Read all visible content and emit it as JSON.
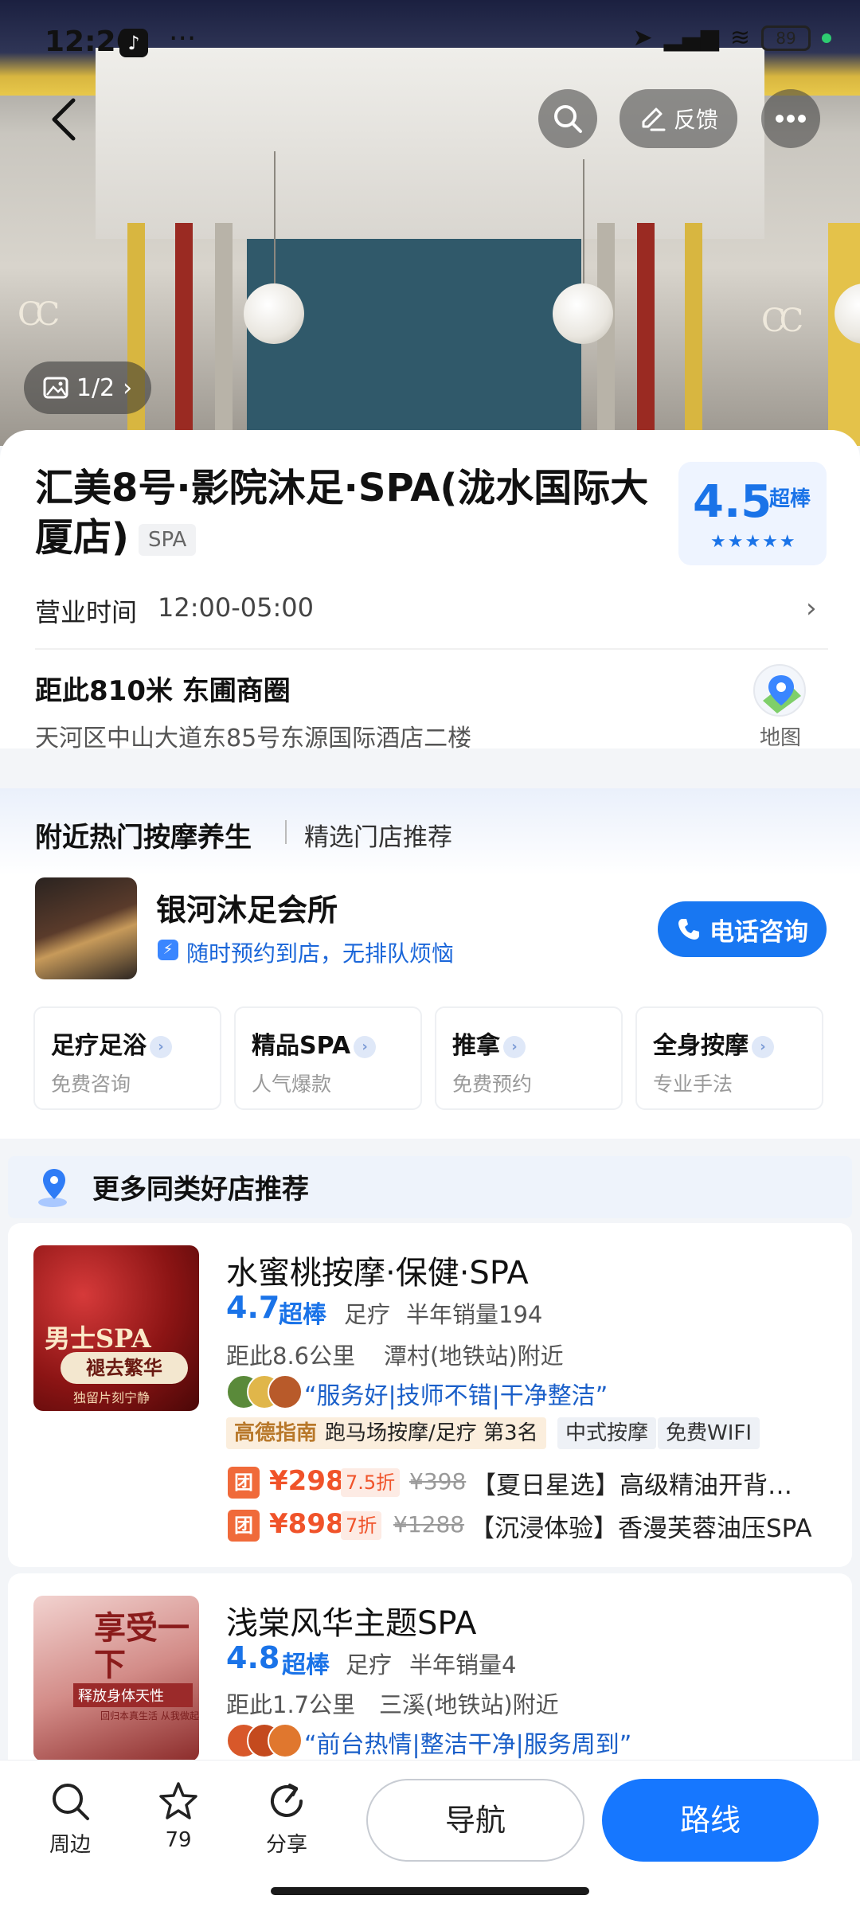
{
  "status_bar": {
    "time": "12:26",
    "battery": "89"
  },
  "header": {
    "feedback_label": "反馈",
    "photo_counter": "1/2"
  },
  "place": {
    "title": "汇美8号·影院沐足·SPA(泷水国际大厦店)",
    "category_tag": "SPA",
    "rating": "4.5",
    "rating_word": "超棒",
    "hours_label": "营业时间",
    "hours_value": "12:00-05:00",
    "distance": "距此810米  东圃商圈",
    "address": "天河区中山大道东85号东源国际酒店二楼",
    "map_label": "地图"
  },
  "nearby": {
    "title": "附近热门按摩养生",
    "subtitle": "精选门店推荐",
    "shop_name": "银河沐足会所",
    "shop_desc": "随时预约到店，无排队烦恼",
    "call_label": "电话咨询",
    "services": [
      {
        "title": "足疗足浴",
        "sub": "免费咨询"
      },
      {
        "title": "精品SPA",
        "sub": "人气爆款"
      },
      {
        "title": "推拿",
        "sub": "免费预约"
      },
      {
        "title": "全身按摩",
        "sub": "专业手法"
      }
    ]
  },
  "more": {
    "title": "更多同类好店推荐",
    "shops": [
      {
        "name": "水蜜桃按摩·保健·SPA",
        "score": "4.7",
        "score_word": "超棒",
        "category": "足疗",
        "sales": "半年销量194",
        "distance": "距此8.6公里",
        "area": "潭村(地铁站)附近",
        "quote": "“服务好|技师不错|干净整洁”",
        "thumb_main": "男士SPA",
        "thumb_sub": "褪去繁华",
        "thumb_sub2": "独留片刻宁静",
        "gaode_label": "高德指南",
        "gaode_rank": "跑马场按摩/足疗 第3名",
        "chips": [
          "中式按摩",
          "免费WIFI"
        ],
        "deals": [
          {
            "icon": "团",
            "price": "¥298",
            "discount": "7.5折",
            "original": "¥398",
            "text": "【夏日星选】高级精油开背…"
          },
          {
            "icon": "团",
            "price": "¥898",
            "discount": "7折",
            "original": "¥1288",
            "text": "【沉浸体验】香漫芙蓉油压SPA"
          }
        ]
      },
      {
        "name": "浅棠风华主题SPA",
        "score": "4.8",
        "score_word": "超棒",
        "category": "足疗",
        "sales": "半年销量4",
        "distance": "距此1.7公里",
        "area": "三溪(地铁站)附近",
        "quote": "“前台热情|整洁干净|服务周到”",
        "thumb_main": "享受一下",
        "thumb_sub": "释放身体天性",
        "thumb_sub2": "回归本真生活  从我做起"
      }
    ]
  },
  "bottom_bar": {
    "nearby_label": "周边",
    "favorite_count": "79",
    "share_label": "分享",
    "navigate_label": "导航",
    "route_label": "路线"
  },
  "colors": {
    "accent": "#1677ff",
    "price": "#f0532a",
    "rating": "#1a73e8"
  }
}
